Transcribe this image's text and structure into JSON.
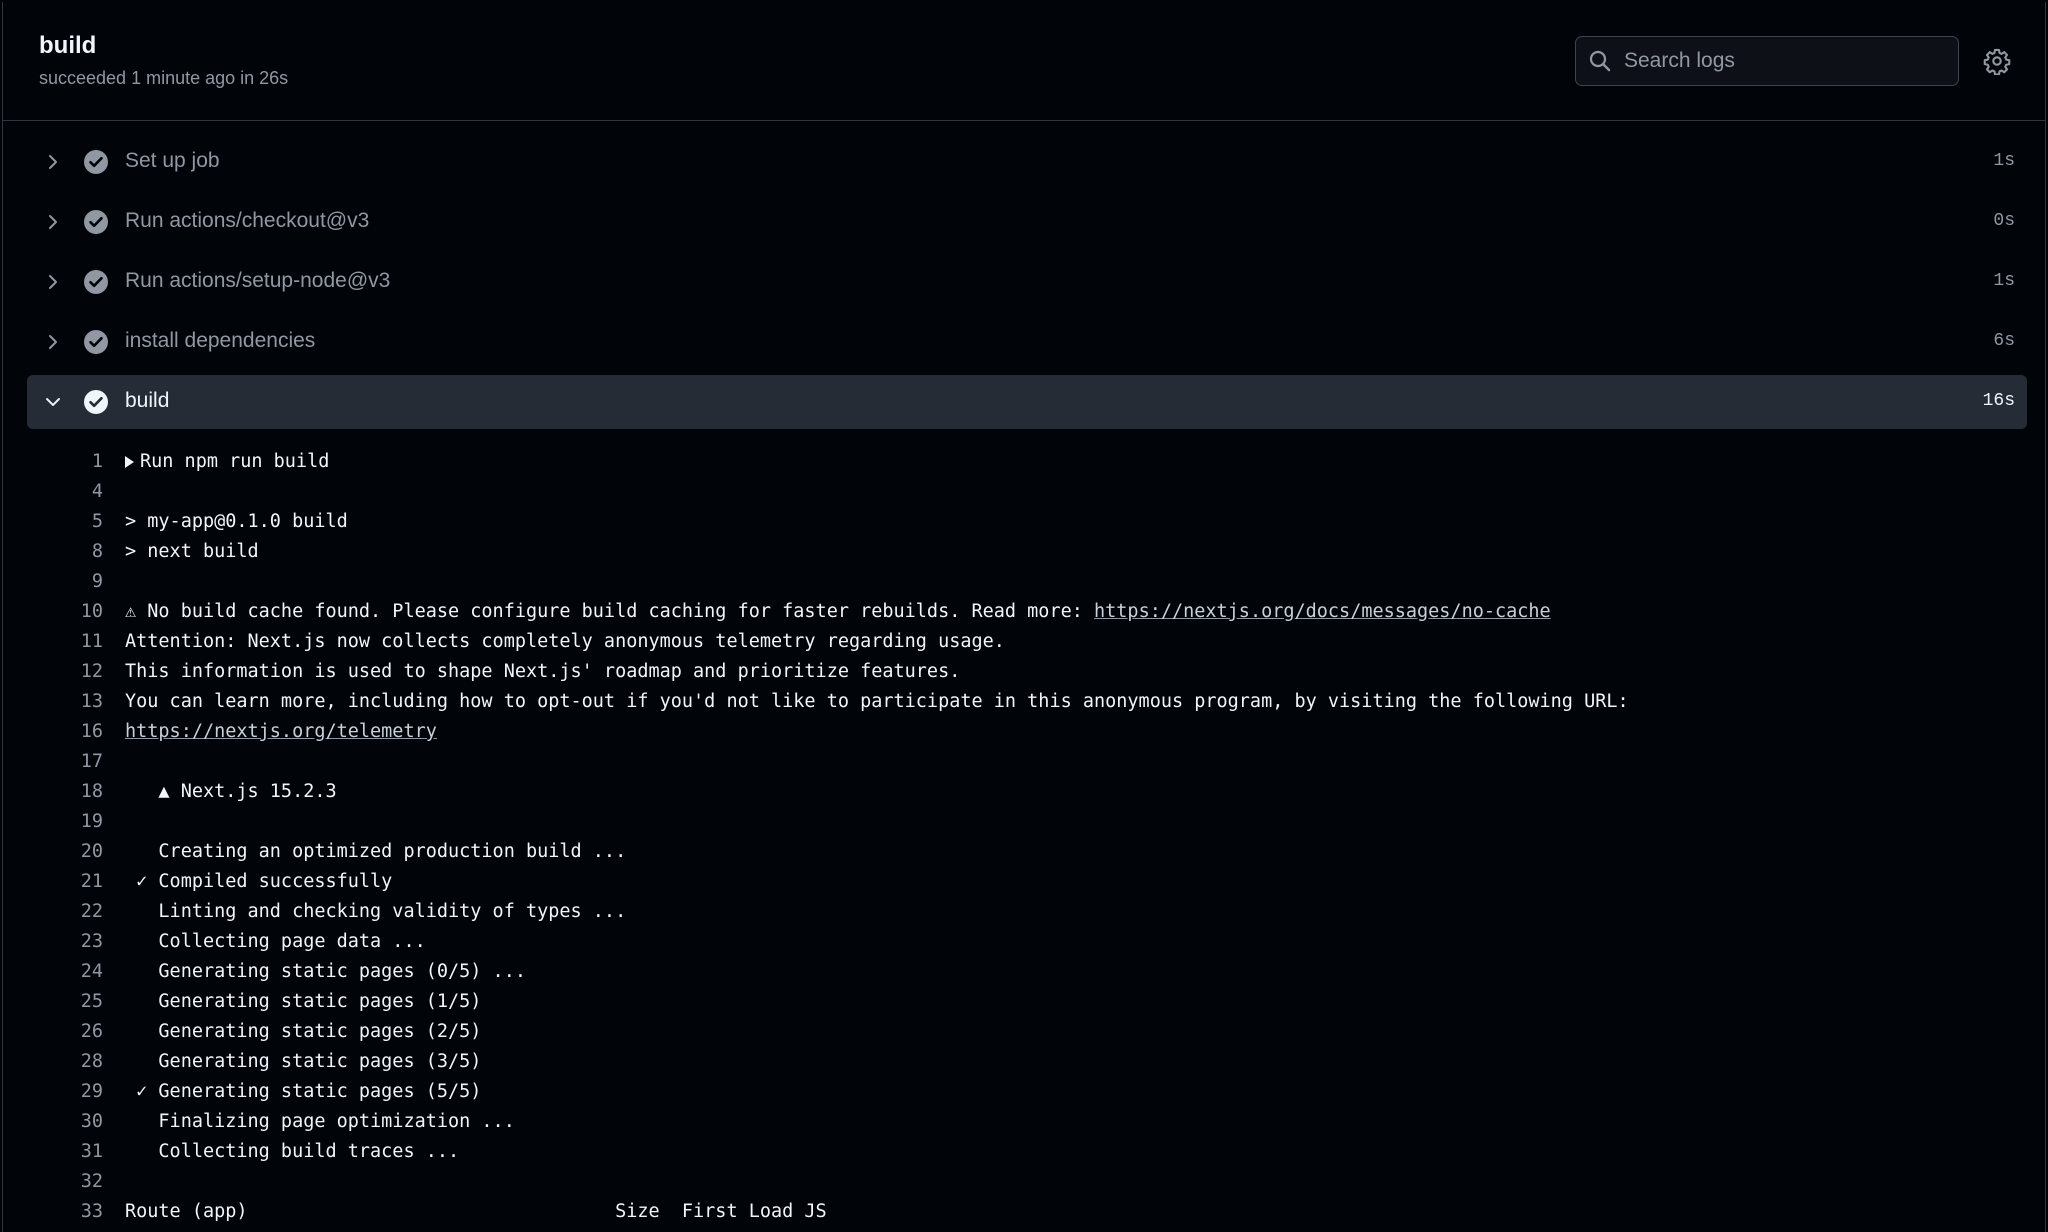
{
  "header": {
    "title": "build",
    "subtitle": "succeeded 1 minute ago in 26s",
    "search_placeholder": "Search logs"
  },
  "steps": [
    {
      "name": "Set up job",
      "duration": "1s",
      "expanded": false
    },
    {
      "name": "Run actions/checkout@v3",
      "duration": "0s",
      "expanded": false
    },
    {
      "name": "Run actions/setup-node@v3",
      "duration": "1s",
      "expanded": false
    },
    {
      "name": "install dependencies",
      "duration": "6s",
      "expanded": false
    },
    {
      "name": "build",
      "duration": "16s",
      "expanded": true
    }
  ],
  "log": [
    {
      "n": "1",
      "text": "Run npm run build",
      "group": true
    },
    {
      "n": "4",
      "text": ""
    },
    {
      "n": "5",
      "text": "> my-app@0.1.0 build"
    },
    {
      "n": "8",
      "text": "> next build"
    },
    {
      "n": "9",
      "text": ""
    },
    {
      "n": "10",
      "text": "⚠ No build cache found. Please configure build caching for faster rebuilds. Read more: ",
      "link": "https://nextjs.org/docs/messages/no-cache"
    },
    {
      "n": "11",
      "text": "Attention: Next.js now collects completely anonymous telemetry regarding usage."
    },
    {
      "n": "12",
      "text": "This information is used to shape Next.js' roadmap and prioritize features."
    },
    {
      "n": "13",
      "text": "You can learn more, including how to opt-out if you'd not like to participate in this anonymous program, by visiting the following URL:"
    },
    {
      "n": "16",
      "text": "",
      "link": "https://nextjs.org/telemetry"
    },
    {
      "n": "17",
      "text": ""
    },
    {
      "n": "18",
      "text": "   ▲ Next.js 15.2.3"
    },
    {
      "n": "19",
      "text": ""
    },
    {
      "n": "20",
      "text": "   Creating an optimized production build ..."
    },
    {
      "n": "21",
      "text": " ✓ Compiled successfully"
    },
    {
      "n": "22",
      "text": "   Linting and checking validity of types ..."
    },
    {
      "n": "23",
      "text": "   Collecting page data ..."
    },
    {
      "n": "24",
      "text": "   Generating static pages (0/5) ..."
    },
    {
      "n": "25",
      "text": "   Generating static pages (1/5)"
    },
    {
      "n": "26",
      "text": "   Generating static pages (2/5)"
    },
    {
      "n": "28",
      "text": "   Generating static pages (3/5)"
    },
    {
      "n": "29",
      "text": " ✓ Generating static pages (5/5)"
    },
    {
      "n": "30",
      "text": "   Finalizing page optimization ..."
    },
    {
      "n": "31",
      "text": "   Collecting build traces ..."
    },
    {
      "n": "32",
      "text": ""
    },
    {
      "n": "33",
      "text": "Route (app)                                 Size  First Load JS"
    }
  ]
}
